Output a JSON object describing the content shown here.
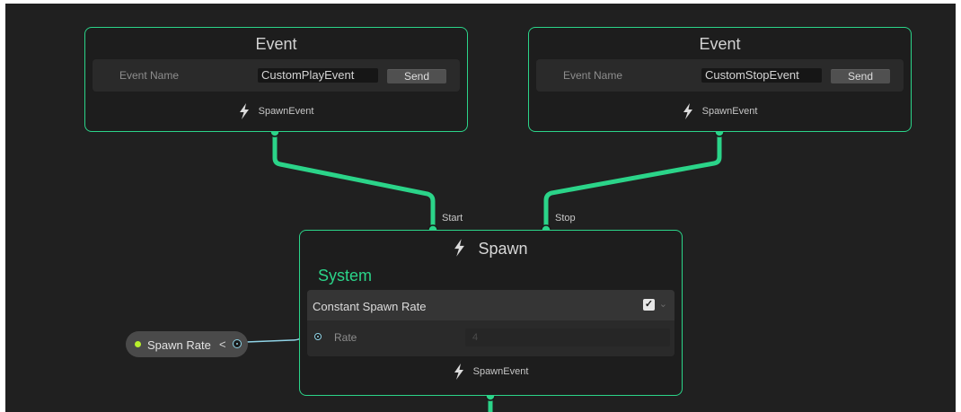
{
  "colors": {
    "canvas": "#202020",
    "node_border": "#2bd489",
    "flow_wire": "#2bd489",
    "value_wire": "#8fd3e6",
    "parameter_dot": "#b8f02c"
  },
  "event_nodes": [
    {
      "title": "Event",
      "field_label": "Event Name",
      "field_value": "CustomPlayEvent",
      "send_label": "Send",
      "output_label": "SpawnEvent",
      "output_icon": "lightning-icon"
    },
    {
      "title": "Event",
      "field_label": "Event Name",
      "field_value": "CustomStopEvent",
      "send_label": "Send",
      "output_label": "SpawnEvent",
      "output_icon": "lightning-icon"
    }
  ],
  "spawn_node": {
    "title": "Spawn",
    "title_icon": "lightning-icon",
    "inputs": [
      "Start",
      "Stop"
    ],
    "system_label": "System",
    "block": {
      "title": "Constant Spawn Rate",
      "enabled": true,
      "property_label": "Rate",
      "property_value": "4"
    },
    "output_label": "SpawnEvent",
    "output_icon": "lightning-icon"
  },
  "parameter": {
    "label": "Spawn Rate",
    "arrow": "<"
  }
}
